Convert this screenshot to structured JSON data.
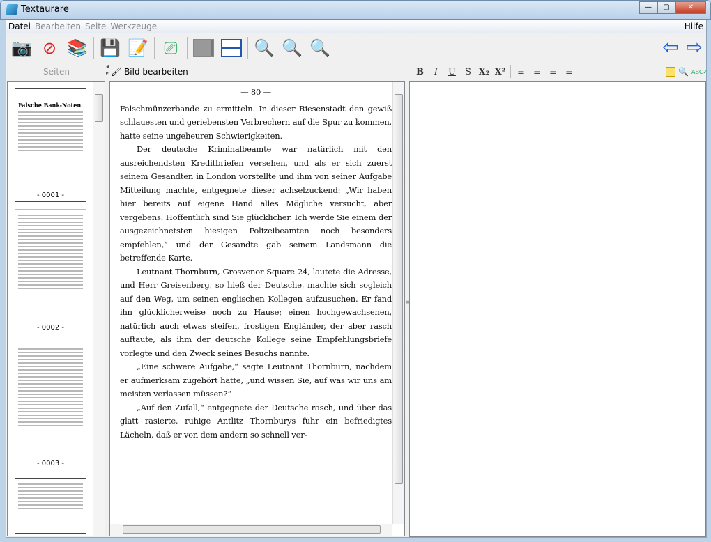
{
  "window": {
    "title": "Textaurare",
    "minimize": "—",
    "maximize": "▢",
    "close": "✕"
  },
  "menu": {
    "items": [
      "Datei",
      "Bearbeiten",
      "Seite",
      "Werkzeuge"
    ],
    "help": "Hilfe"
  },
  "toolbar": {
    "icons": [
      "camera-icon",
      "pdf-icon",
      "books-icon",
      "save-icon",
      "save-edit-icon",
      "scanner-icon",
      "two-columns-icon",
      "two-rows-icon",
      "zoom-out-icon",
      "zoom-fit-icon",
      "zoom-in-icon"
    ],
    "back": "⇦",
    "forward": "⇨"
  },
  "sidebar": {
    "header": "Seiten",
    "thumbnails": [
      {
        "title": "Falsche Bank-Noten.",
        "label": "- 0001 -"
      },
      {
        "label": "- 0002 -"
      },
      {
        "label": "- 0003 -"
      },
      {
        "label": ""
      }
    ]
  },
  "image_pane": {
    "header": "Bild bearbeiten",
    "page_number": "— 80 —",
    "paragraphs": [
      {
        "indent": false,
        "text": "Falschmünzerbande zu ermitteln. In dieser Riesenstadt den gewiß schlauesten und geriebensten Verbrechern auf die Spur zu kommen, hatte seine ungeheuren Schwierigkeiten."
      },
      {
        "indent": true,
        "text": "Der deutsche Kriminalbeamte war natürlich mit den ausreichendsten Kreditbriefen versehen, und als er sich zuerst seinem Gesandten in London vorstellte und ihm von seiner Aufgabe Mitteilung machte, entgegnete dieser achselzuckend: „Wir haben hier bereits auf eigene Hand alles Mögliche versucht, aber vergebens. Hoffentlich sind Sie glücklicher. Ich werde Sie einem der ausgezeichnetsten hiesigen Polizeibeamten noch besonders empfehlen,“ und der Gesandte gab seinem Landsmann die betreffende Karte."
      },
      {
        "indent": true,
        "text": "Leutnant Thornburn, Grosvenor Square 24, lautete die Adresse, und Herr Greisenberg, so hieß der Deutsche, machte sich sogleich auf den Weg, um seinen englischen Kollegen aufzusuchen. Er fand ihn glücklicherweise noch zu Hause; einen hochgewachsenen, natürlich auch etwas steifen, frostigen Engländer, der aber rasch auftaute, als ihm der deutsche Kollege seine Empfehlungsbriefe vorlegte und den Zweck seines Besuchs nannte."
      },
      {
        "indent": true,
        "text": "„Eine schwere Aufgabe,“ sagte Leutnant Thornburn, nachdem er aufmerksam zugehört hatte, „und wissen Sie, auf was wir uns am meisten verlassen müssen?“"
      },
      {
        "indent": true,
        "text": "„Auf den Zufall,“ entgegnete der Deutsche rasch, und über das glatt rasierte, ruhige Antlitz Thornburys fuhr ein befriedigtes Lächeln, daß er von dem andern so schnell ver-"
      }
    ]
  },
  "editor": {
    "format_buttons": [
      "B",
      "I",
      "U",
      "S",
      "X₂",
      "X²"
    ],
    "align_buttons": [
      "≡",
      "≡",
      "≡",
      "≡"
    ],
    "right_icons": [
      "note-icon",
      "search-icon",
      "spellcheck-icon"
    ],
    "text": ""
  }
}
